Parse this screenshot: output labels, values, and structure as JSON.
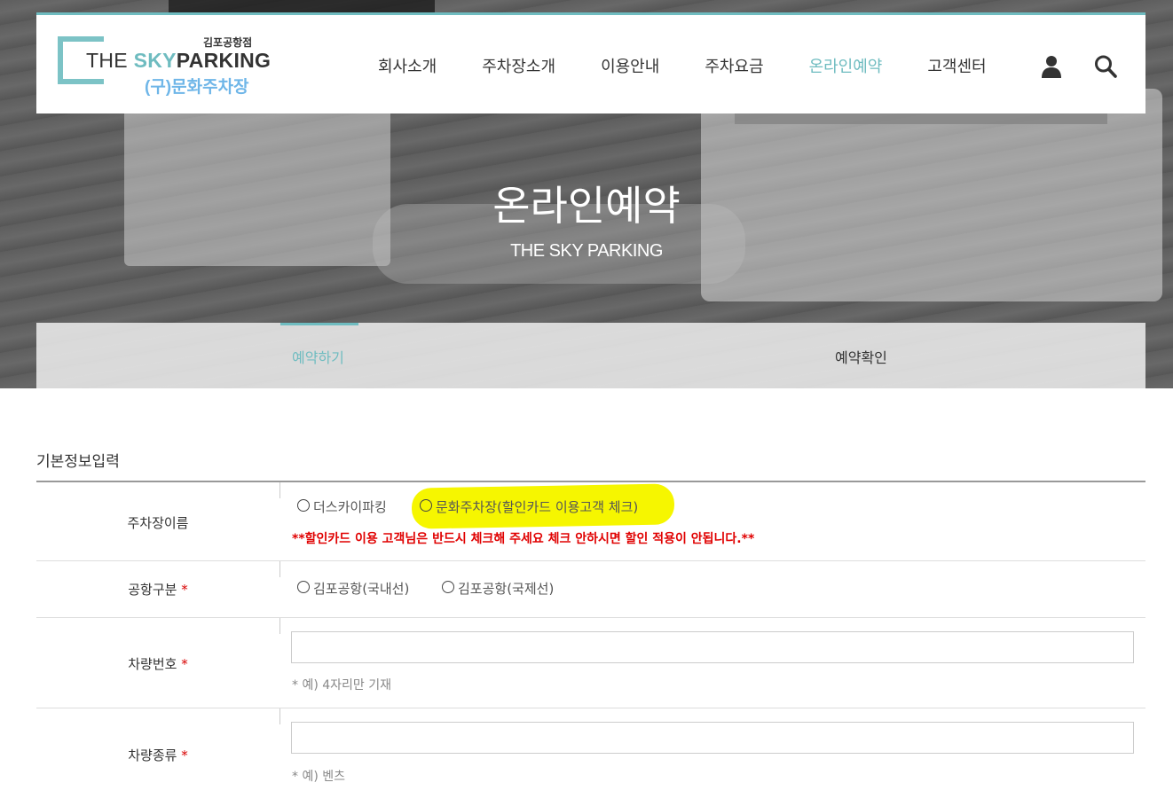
{
  "header": {
    "logo": {
      "branch": "김포공항점",
      "name_the": "THE ",
      "name_sky": "SKY",
      "name_parking": "PARKING",
      "former_name": "(구)문화주차장"
    },
    "nav": [
      "회사소개",
      "주차장소개",
      "이용안내",
      "주차요금",
      "온라인예약",
      "고객센터"
    ],
    "active_nav": "온라인예약"
  },
  "hero": {
    "title": "온라인예약",
    "subtitle": "THE SKY PARKING"
  },
  "tabs": {
    "reserve": "예약하기",
    "confirm": "예약확인"
  },
  "form": {
    "section_title": "기본정보입력",
    "parking_name": {
      "label": "주차장이름",
      "options": [
        "더스카이파킹",
        "문화주차장(할인카드 이용고객 체크)"
      ],
      "warning": "**할인카드 이용 고객님은 반드시 체크해 주세요 체크 안하시면 할인 적용이 안됩니다.**"
    },
    "airport": {
      "label": "공항구분",
      "required_mark": "*",
      "options": [
        "김포공항(국내선)",
        "김포공항(국제선)"
      ]
    },
    "car_number": {
      "label": "차량번호",
      "required_mark": "*",
      "value": "",
      "hint": "* 예) 4자리만 기재"
    },
    "car_type": {
      "label": "차량종류",
      "required_mark": "*",
      "value": "",
      "hint": "* 예) 벤츠"
    }
  },
  "colors": {
    "accent": "#6fbcc0",
    "warning": "#e00000",
    "highlight": "#f6f600"
  }
}
